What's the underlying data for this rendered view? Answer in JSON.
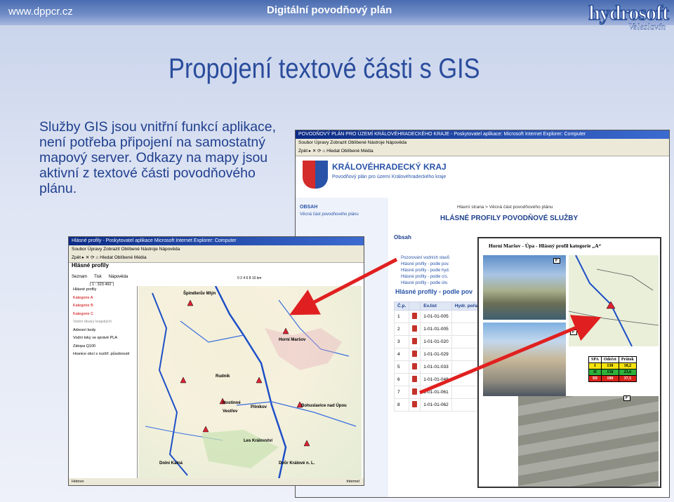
{
  "header": {
    "site": "www.dppcr.cz",
    "subtitle": "Digitální povodňový plán",
    "logo_main": "hydrosoft",
    "logo_sub": "Veleslavín"
  },
  "headline": "Propojení textové části s GIS",
  "body_text": "Služby GIS jsou vnitřní funkcí aplikace, není potřeba připojení na samostatný mapový server. Odkazy na mapy jsou aktivní z textové části povodňového plánu.",
  "win_portal": {
    "title": "POVODŇOVÝ PLÁN PRO ÚZEMÍ KRÁLOVÉHRADECKÉHO KRAJE - Poskytovatel aplikace: Microsoft Internet Explorer: Computer",
    "menu": "Soubor  Úpravy  Zobrazit  Oblíbené  Nástroje  Nápověda",
    "toolbar": "Zpět  ▸  ✕  ⟳  ⌂  Hledat  Oblíbené  Média",
    "kraj": "KRÁLOVÉHRADECKÝ KRAJ",
    "kraj_sub": "Povodňový plán pro území Královéhradeckého kraje",
    "crumb": "Hlavní strana > Věcná část povodňového plánu",
    "heading": "HLÁSNÉ PROFILY POVODŇOVÉ SLUŽBY",
    "sidebar_head": "OBSAH",
    "sidebar_link": "Věcná část povodňového plánu",
    "obsah": "Obsah",
    "obsah_list": [
      "Pozorování vodních stavů",
      "Hlásné profily - podle pov.",
      "Hlásné profily - podle hyd.",
      "Hlásné profily - podle cís.",
      "Hlásné profily - podle útv."
    ],
    "table_heading": "Hlásné profily - podle pov",
    "table_cols": [
      "Č.p.",
      "Ev.list",
      "Hydr. pořadí"
    ],
    "table_rows": [
      [
        "1",
        "1-01-01-005"
      ],
      [
        "2",
        "1-01-01-005"
      ],
      [
        "3",
        "1-01-01-020"
      ],
      [
        "4",
        "1-01-01-029"
      ],
      [
        "5",
        "1-01-01-033"
      ],
      [
        "6",
        "1-01-01-048"
      ],
      [
        "7",
        "1-01-01-061"
      ],
      [
        "8",
        "1-01-01-062"
      ]
    ]
  },
  "win_gis": {
    "title": "Hlásné profily - Poskytovatel aplikace Microsoft Internet Explorer: Computer",
    "menu": "Soubor  Úpravy  Zobrazit  Oblíbené  Nástroje  Nápověda",
    "toolbar": "Zpět  ▸  ✕  ⟳  ⌂  Hledat  Oblíbené  Média",
    "page_title": "Hlásné profily",
    "tabs": [
      "Seznam",
      "Tisk",
      "Nápověda"
    ],
    "scale": "1 : 323 492",
    "scale_km": "0   2   4   6   8   10 km",
    "layers": [
      "Hlásné profily",
      "Kategorie A",
      "Kategorie B",
      "Kategorie C",
      "Vodní útvary krajských",
      "Adresní body",
      "Vodní toky ve správě PLA",
      "Zátopa Q100",
      "Hranice obcí s rozšíř. působností"
    ],
    "towns": [
      "Špindlerův Mlýn",
      "Horní Maršov",
      "Rudník",
      "Hostinné",
      "Vestřev",
      "Pilníkov",
      "Bohuslavice nad Úpou",
      "Les Království",
      "Dolní Kalná",
      "Dvůr Králové n. L."
    ],
    "status_left": "Hotovo",
    "status_right": "Internet"
  },
  "win_profile": {
    "title": "Horní Maršov - Úpa - Hlásný profil kategorie „A“",
    "table_cols": [
      "SPA",
      "Odečet",
      "Průtok"
    ],
    "table_rows": [
      [
        "I",
        "130",
        "18,2"
      ],
      [
        "II",
        "150",
        "23,6"
      ],
      [
        "III",
        "180",
        "37,5"
      ]
    ],
    "label_f": "F",
    "status_left": "Hotovo",
    "zoom": "100%"
  },
  "colors": {
    "accent": "#2a4c9c",
    "arrow": "#e02020"
  }
}
